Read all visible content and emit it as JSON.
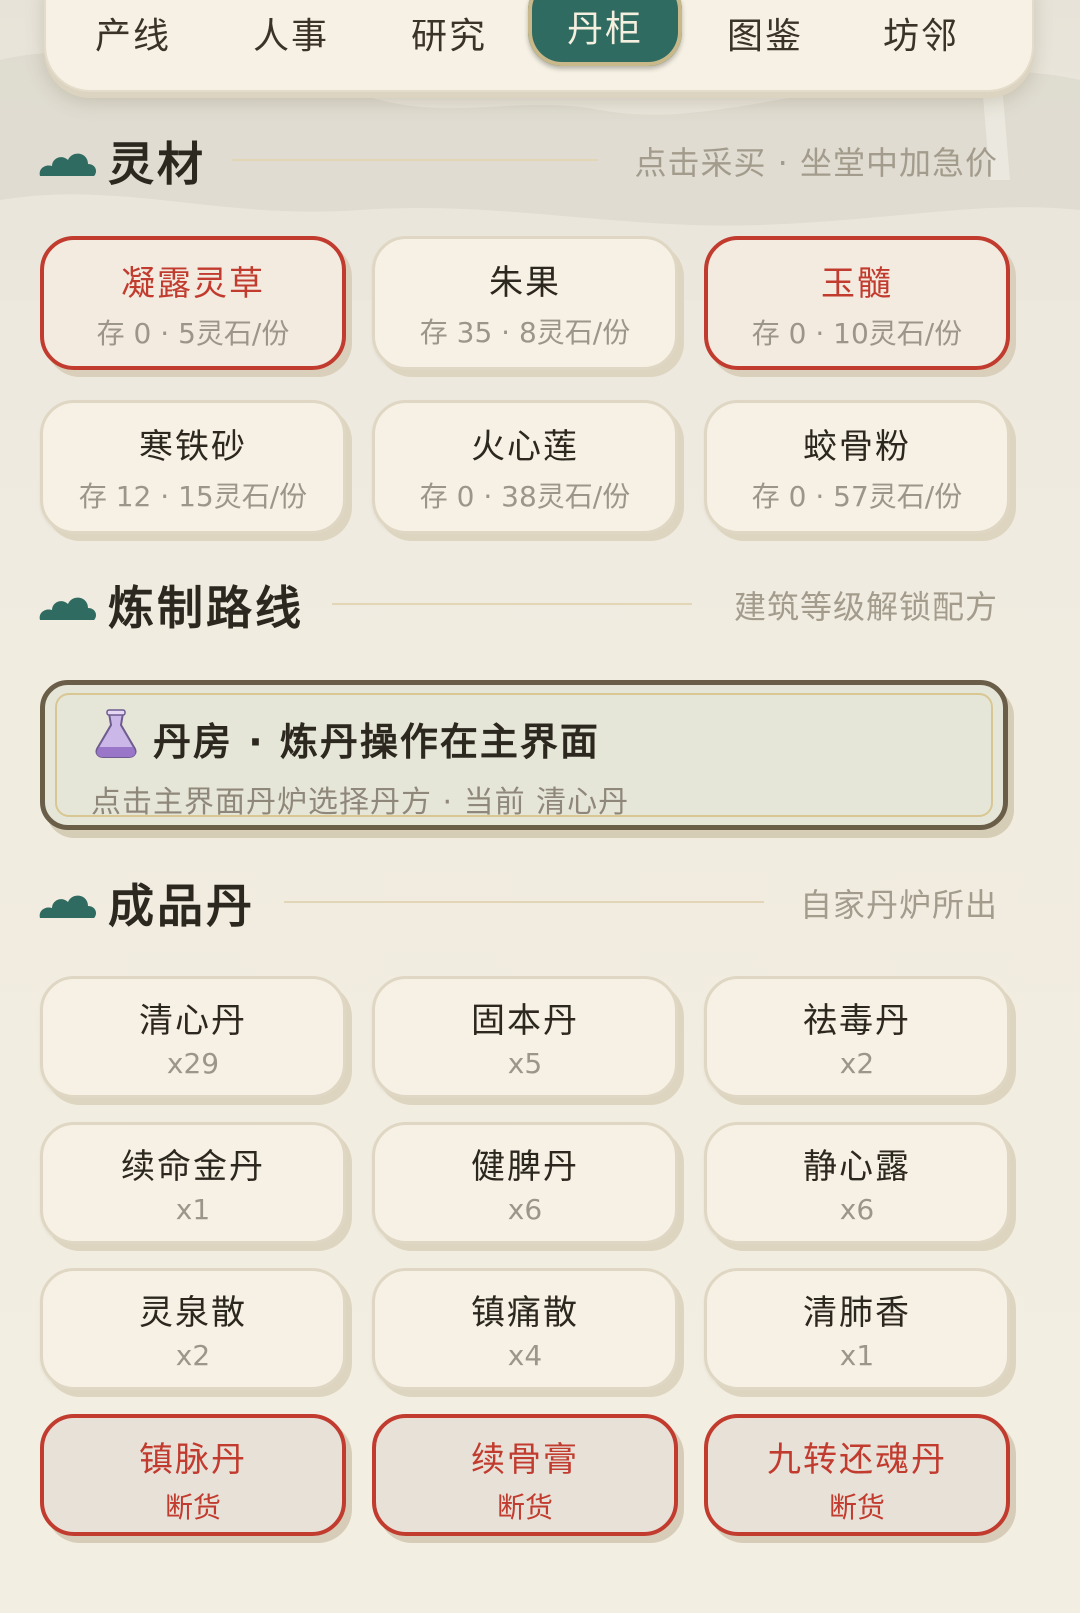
{
  "tabs": [
    {
      "label": "产线",
      "active": false
    },
    {
      "label": "人事",
      "active": false
    },
    {
      "label": "研究",
      "active": false
    },
    {
      "label": "丹柜",
      "active": true
    },
    {
      "label": "图鉴",
      "active": false
    },
    {
      "label": "坊邻",
      "active": false
    }
  ],
  "sections": {
    "materials": {
      "title": "灵材",
      "hint": "点击采买 · 坐堂中加急价",
      "icon": "cloud-icon"
    },
    "routes": {
      "title": "炼制路线",
      "hint": "建筑等级解锁配方",
      "icon": "cloud-icon"
    },
    "pills": {
      "title": "成品丹",
      "hint": "自家丹炉所出",
      "icon": "cloud-icon"
    }
  },
  "materials": [
    {
      "name": "凝露灵草",
      "info": "存 0 · 5灵石/份",
      "alert": true
    },
    {
      "name": "朱果",
      "info": "存 35 · 8灵石/份",
      "alert": false
    },
    {
      "name": "玉髓",
      "info": "存 0 · 10灵石/份",
      "alert": true
    },
    {
      "name": "寒铁砂",
      "info": "存 12 · 15灵石/份",
      "alert": false
    },
    {
      "name": "火心莲",
      "info": "存 0 · 38灵石/份",
      "alert": false
    },
    {
      "name": "蛟骨粉",
      "info": "存 0 · 57灵石/份",
      "alert": false
    }
  ],
  "route": {
    "icon": "flask-icon",
    "title": "丹房 · 炼丹操作在主界面",
    "desc": "点击主界面丹炉选择丹方 · 当前 清心丹"
  },
  "pills": [
    {
      "name": "清心丹",
      "qty": "x29",
      "out": false
    },
    {
      "name": "固本丹",
      "qty": "x5",
      "out": false
    },
    {
      "name": "祛毒丹",
      "qty": "x2",
      "out": false
    },
    {
      "name": "续命金丹",
      "qty": "x1",
      "out": false
    },
    {
      "name": "健脾丹",
      "qty": "x6",
      "out": false
    },
    {
      "name": "静心露",
      "qty": "x6",
      "out": false
    },
    {
      "name": "灵泉散",
      "qty": "x2",
      "out": false
    },
    {
      "name": "镇痛散",
      "qty": "x4",
      "out": false
    },
    {
      "name": "清肺香",
      "qty": "x1",
      "out": false
    },
    {
      "name": "镇脉丹",
      "qty": "断货",
      "out": true
    },
    {
      "name": "续骨膏",
      "qty": "断货",
      "out": true
    },
    {
      "name": "九转还魂丹",
      "qty": "断货",
      "out": true
    }
  ],
  "colors": {
    "accent": "#2f6b61",
    "alert": "#c13b2e",
    "panel": "#f6f1e4"
  }
}
